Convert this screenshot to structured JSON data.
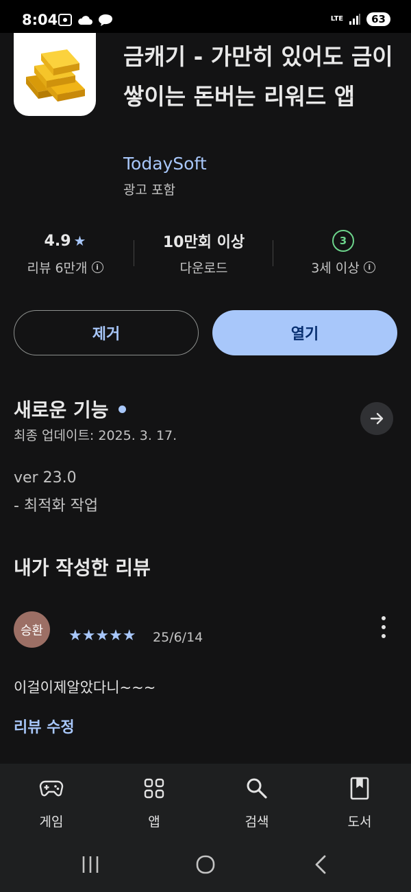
{
  "status_bar": {
    "time": "8:04",
    "network": "LTE",
    "battery": "63"
  },
  "app": {
    "title": "금캐기 - 가만히 있어도 금이 쌓이는 돈버는 리워드 앱",
    "developer": "TodaySoft",
    "ads": "광고 포함",
    "icon": "gold-bars-icon"
  },
  "stats": {
    "rating": "4.9",
    "rating_star": "★",
    "reviews": "리뷰 6만개",
    "downloads": "10만회 이상",
    "downloads_label": "다운로드",
    "age_badge": "3",
    "age_label": "3세 이상"
  },
  "actions": {
    "remove_label": "제거",
    "open_label": "열기"
  },
  "whats_new": {
    "title": "새로운 기능",
    "updated": "최종 업데이트: 2025. 3. 17.",
    "version": "ver 23.0",
    "note": "- 최적화 작업"
  },
  "my_review": {
    "title": "내가 작성한 리뷰",
    "avatar_text": "승환",
    "stars": "★★★★★",
    "rating": 5,
    "date": "25/6/14",
    "text": "이걸이제알았다니~~~",
    "edit_label": "리뷰 수정"
  },
  "bottom_nav": {
    "items": [
      {
        "label": "게임",
        "icon": "gamepad-icon"
      },
      {
        "label": "앱",
        "icon": "apps-grid-icon"
      },
      {
        "label": "검색",
        "icon": "search-icon"
      },
      {
        "label": "도서",
        "icon": "book-icon"
      }
    ]
  },
  "colors": {
    "accent": "#a8c7fa",
    "background": "#131314",
    "open_button_text": "#062e6f",
    "age_green": "#6dd58c"
  }
}
